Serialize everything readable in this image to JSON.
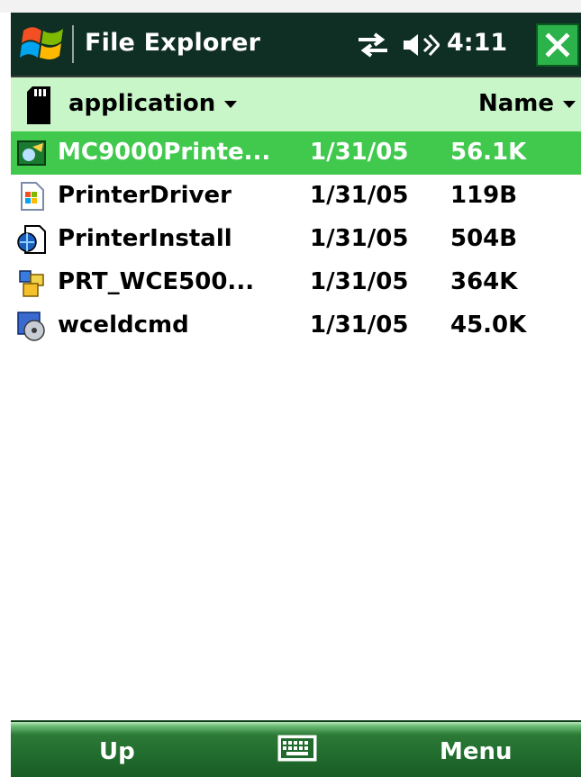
{
  "titlebar": {
    "start_icon": "windows-flag-icon",
    "title": "File Explorer",
    "connectivity_icon": "connectivity-arrows-icon",
    "volume_icon": "speaker-volume-icon",
    "clock": "4:11",
    "close_icon": "close-x-icon"
  },
  "pathbar": {
    "storage_icon": "sd-card-icon",
    "folder": "application",
    "sort": "Name"
  },
  "files": [
    {
      "name": "MC9000Printe...",
      "date": "1/31/05",
      "size": "56.1K",
      "icon": "executable-icon",
      "selected": true
    },
    {
      "name": "PrinterDriver",
      "date": "1/31/05",
      "size": "119B",
      "icon": "shortcut-windows-icon",
      "selected": false
    },
    {
      "name": "PrinterInstall",
      "date": "1/31/05",
      "size": "504B",
      "icon": "script-globe-icon",
      "selected": false
    },
    {
      "name": "PRT_WCE500...",
      "date": "1/31/05",
      "size": "364K",
      "icon": "cab-package-icon",
      "selected": false
    },
    {
      "name": "wceldcmd",
      "date": "1/31/05",
      "size": "45.0K",
      "icon": "program-disk-icon",
      "selected": false
    }
  ],
  "softkeys": {
    "left": "Up",
    "center_icon": "keyboard-icon",
    "right": "Menu"
  },
  "colors": {
    "titlebar_bg": "#0f2f24",
    "pathbar_bg": "#c8f6c8",
    "selected_row": "#41c94e",
    "softbar_bg": "#1f6a2c"
  }
}
